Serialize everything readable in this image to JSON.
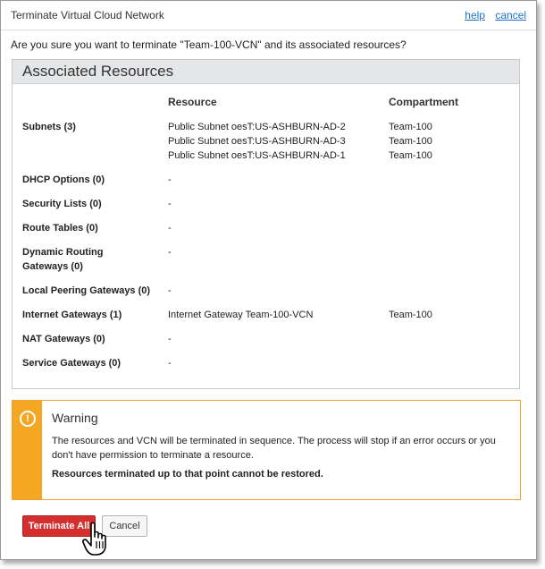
{
  "dialog": {
    "title": "Terminate Virtual Cloud Network",
    "help_link": "help",
    "cancel_link": "cancel",
    "question": "Are you sure you want to terminate \"Team-100-VCN\" and its associated resources?"
  },
  "resources": {
    "heading": "Associated Resources",
    "col_resource": "Resource",
    "col_compartment": "Compartment",
    "rows": [
      {
        "label": "Subnets (3)",
        "res": [
          "Public Subnet oesT:US-ASHBURN-AD-2",
          "Public Subnet oesT:US-ASHBURN-AD-3",
          "Public Subnet oesT:US-ASHBURN-AD-1"
        ],
        "comp": [
          "Team-100",
          "Team-100",
          "Team-100"
        ]
      },
      {
        "label": "DHCP Options (0)",
        "res": [
          "-"
        ],
        "comp": []
      },
      {
        "label": "Security Lists (0)",
        "res": [
          "-"
        ],
        "comp": []
      },
      {
        "label": "Route Tables (0)",
        "res": [
          "-"
        ],
        "comp": []
      },
      {
        "label": "Dynamic Routing Gateways (0)",
        "res": [
          "-"
        ],
        "comp": []
      },
      {
        "label": "Local Peering Gateways (0)",
        "res": [
          "-"
        ],
        "comp": []
      },
      {
        "label": "Internet Gateways (1)",
        "res": [
          "Internet Gateway Team-100-VCN"
        ],
        "comp": [
          "Team-100"
        ]
      },
      {
        "label": "NAT Gateways (0)",
        "res": [
          "-"
        ],
        "comp": []
      },
      {
        "label": "Service Gateways (0)",
        "res": [
          "-"
        ],
        "comp": []
      }
    ]
  },
  "warning": {
    "icon": "exclamation-circle-icon",
    "title": "Warning",
    "text": "The resources and VCN will be terminated in sequence. The process will stop if an error occurs or you don't have permission to terminate a resource.",
    "bold_text": "Resources terminated up to that point cannot be restored.",
    "accent": "#f5a623"
  },
  "buttons": {
    "terminate_all": "Terminate All",
    "cancel": "Cancel",
    "terminate_color": "#d42e2e"
  }
}
